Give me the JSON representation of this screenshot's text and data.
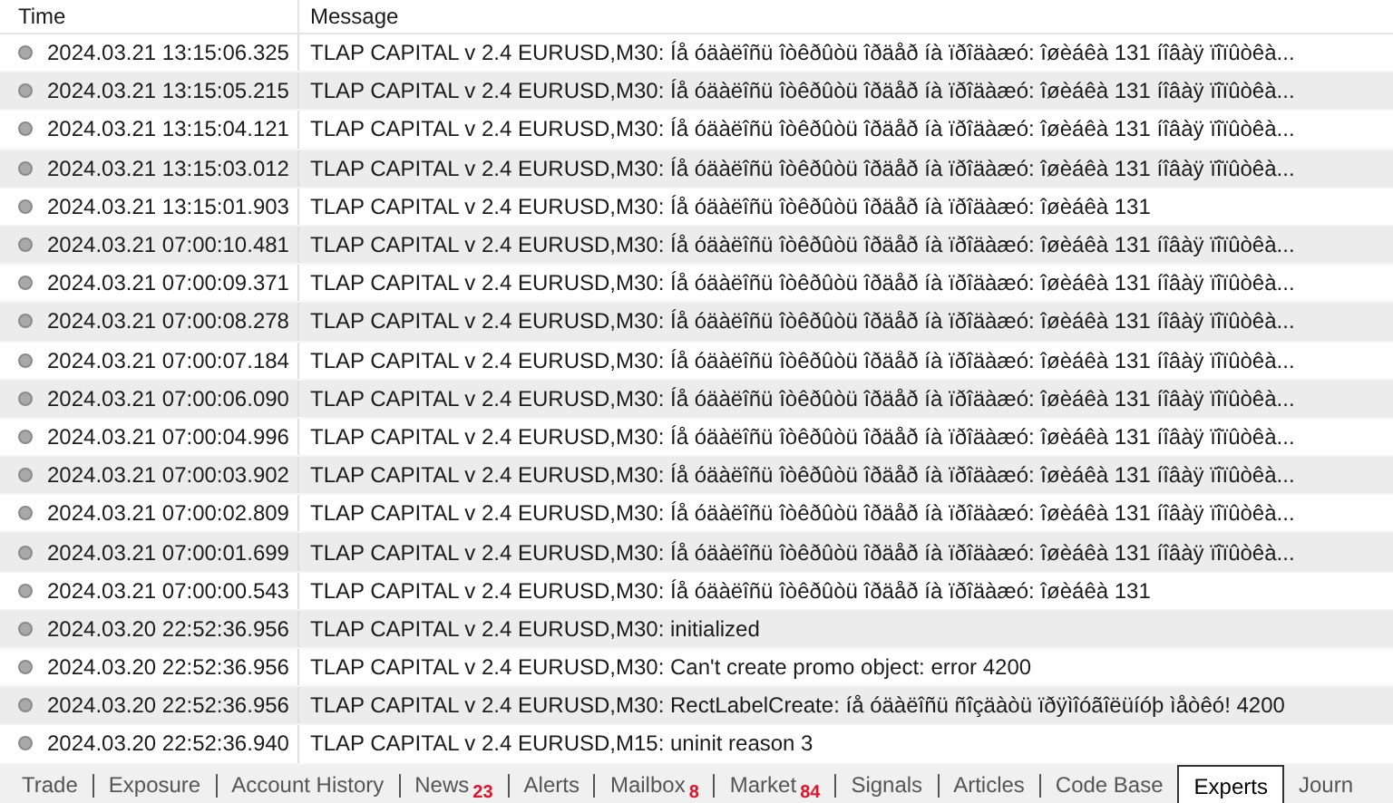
{
  "table": {
    "columns": [
      "Time",
      "Message"
    ],
    "rows": [
      {
        "time": "2024.03.21 13:15:06.325",
        "message": "TLAP CAPITAL v 2.4 EURUSD,M30: Íå óäàëîñü îòêðûòü îðäåð íà ïðîäàæó: îøèáêà 131 íîâàÿ ïîïûòêà..."
      },
      {
        "time": "2024.03.21 13:15:05.215",
        "message": "TLAP CAPITAL v 2.4 EURUSD,M30: Íå óäàëîñü îòêðûòü îðäåð íà ïðîäàæó: îøèáêà 131 íîâàÿ ïîïûòêà..."
      },
      {
        "time": "2024.03.21 13:15:04.121",
        "message": "TLAP CAPITAL v 2.4 EURUSD,M30: Íå óäàëîñü îòêðûòü îðäåð íà ïðîäàæó: îøèáêà 131 íîâàÿ ïîïûòêà..."
      },
      {
        "time": "2024.03.21 13:15:03.012",
        "message": "TLAP CAPITAL v 2.4 EURUSD,M30: Íå óäàëîñü îòêðûòü îðäåð íà ïðîäàæó: îøèáêà 131 íîâàÿ ïîïûòêà..."
      },
      {
        "time": "2024.03.21 13:15:01.903",
        "message": "TLAP CAPITAL v 2.4 EURUSD,M30: Íå óäàëîñü îòêðûòü îðäåð íà ïðîäàæó: îøèáêà 131"
      },
      {
        "time": "2024.03.21 07:00:10.481",
        "message": "TLAP CAPITAL v 2.4 EURUSD,M30: Íå óäàëîñü îòêðûòü îðäåð íà ïðîäàæó: îøèáêà 131 íîâàÿ ïîïûòêà..."
      },
      {
        "time": "2024.03.21 07:00:09.371",
        "message": "TLAP CAPITAL v 2.4 EURUSD,M30: Íå óäàëîñü îòêðûòü îðäåð íà ïðîäàæó: îøèáêà 131 íîâàÿ ïîïûòêà..."
      },
      {
        "time": "2024.03.21 07:00:08.278",
        "message": "TLAP CAPITAL v 2.4 EURUSD,M30: Íå óäàëîñü îòêðûòü îðäåð íà ïðîäàæó: îøèáêà 131 íîâàÿ ïîïûòêà..."
      },
      {
        "time": "2024.03.21 07:00:07.184",
        "message": "TLAP CAPITAL v 2.4 EURUSD,M30: Íå óäàëîñü îòêðûòü îðäåð íà ïðîäàæó: îøèáêà 131 íîâàÿ ïîïûòêà..."
      },
      {
        "time": "2024.03.21 07:00:06.090",
        "message": "TLAP CAPITAL v 2.4 EURUSD,M30: Íå óäàëîñü îòêðûòü îðäåð íà ïðîäàæó: îøèáêà 131 íîâàÿ ïîïûòêà..."
      },
      {
        "time": "2024.03.21 07:00:04.996",
        "message": "TLAP CAPITAL v 2.4 EURUSD,M30: Íå óäàëîñü îòêðûòü îðäåð íà ïðîäàæó: îøèáêà 131 íîâàÿ ïîïûòêà..."
      },
      {
        "time": "2024.03.21 07:00:03.902",
        "message": "TLAP CAPITAL v 2.4 EURUSD,M30: Íå óäàëîñü îòêðûòü îðäåð íà ïðîäàæó: îøèáêà 131 íîâàÿ ïîïûòêà..."
      },
      {
        "time": "2024.03.21 07:00:02.809",
        "message": "TLAP CAPITAL v 2.4 EURUSD,M30: Íå óäàëîñü îòêðûòü îðäåð íà ïðîäàæó: îøèáêà 131 íîâàÿ ïîïûòêà..."
      },
      {
        "time": "2024.03.21 07:00:01.699",
        "message": "TLAP CAPITAL v 2.4 EURUSD,M30: Íå óäàëîñü îòêðûòü îðäåð íà ïðîäàæó: îøèáêà 131 íîâàÿ ïîïûòêà..."
      },
      {
        "time": "2024.03.21 07:00:00.543",
        "message": "TLAP CAPITAL v 2.4 EURUSD,M30: Íå óäàëîñü îòêðûòü îðäåð íà ïðîäàæó: îøèáêà 131"
      },
      {
        "time": "2024.03.20 22:52:36.956",
        "message": "TLAP CAPITAL v 2.4 EURUSD,M30: initialized"
      },
      {
        "time": "2024.03.20 22:52:36.956",
        "message": "TLAP CAPITAL v 2.4 EURUSD,M30: Can't create promo object: error 4200"
      },
      {
        "time": "2024.03.20 22:52:36.956",
        "message": "TLAP CAPITAL v 2.4 EURUSD,M30: RectLabelCreate: íå óäàëîñü ñîçäàòü ïðÿìîóãîëüíóþ ìåòêó! 4200"
      },
      {
        "time": "2024.03.20 22:52:36.940",
        "message": "TLAP CAPITAL v 2.4 EURUSD,M15: uninit reason 3"
      }
    ]
  },
  "tabs": [
    {
      "label": "Trade",
      "selected": false
    },
    {
      "label": "Exposure",
      "selected": false
    },
    {
      "label": "Account History",
      "selected": false
    },
    {
      "label": "News",
      "badge": "23",
      "selected": false
    },
    {
      "label": "Alerts",
      "selected": false
    },
    {
      "label": "Mailbox",
      "badge": "8",
      "selected": false
    },
    {
      "label": "Market",
      "badge": "84",
      "selected": false
    },
    {
      "label": "Signals",
      "selected": false
    },
    {
      "label": "Articles",
      "selected": false
    },
    {
      "label": "Code Base",
      "selected": false
    },
    {
      "label": "Experts",
      "selected": true
    },
    {
      "label": "Journ",
      "selected": false
    }
  ]
}
